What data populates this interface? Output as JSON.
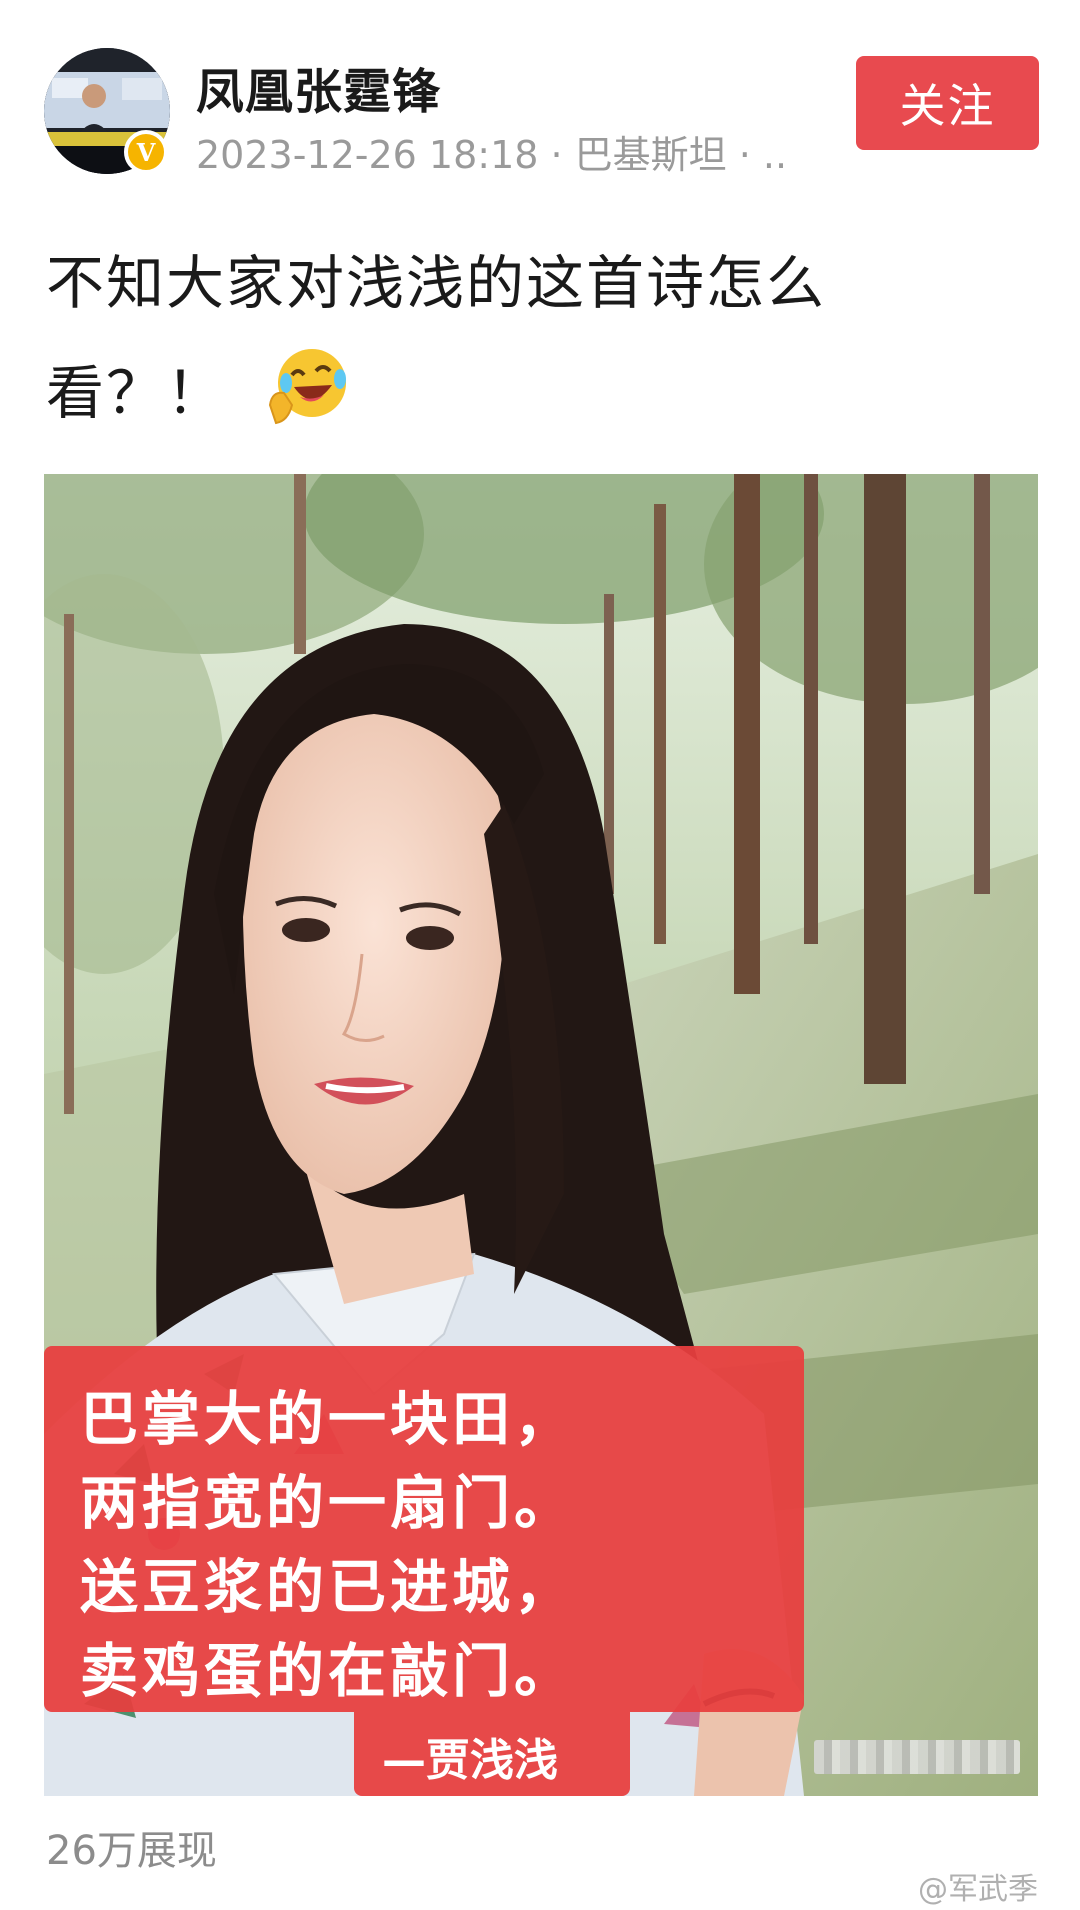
{
  "post": {
    "author": {
      "name": "凤凰张霆锋",
      "verified_badge": "V",
      "avatar_icon": "news-anchor-avatar"
    },
    "meta": "2023-12-26 18:18 · 巴基斯坦 · ..",
    "follow_label": "关注",
    "text_line1": "不知大家对浅浅的这首诗怎么",
    "text_line2": "看？！",
    "emoji_icon": "laughing-crying-emoji",
    "image": {
      "poem_lines": [
        "巴掌大的一块田，",
        "两指宽的一扇门。",
        "送豆浆的已进城，",
        "卖鸡蛋的在敲门。"
      ],
      "poem_author": "—贾浅浅"
    },
    "views": "26万展现"
  },
  "watermark": "@军武季",
  "colors": {
    "follow_button": "#e84a4f",
    "poem_box": "#e83f3f",
    "badge": "#f6b400",
    "meta_text": "#9a9a9a"
  }
}
